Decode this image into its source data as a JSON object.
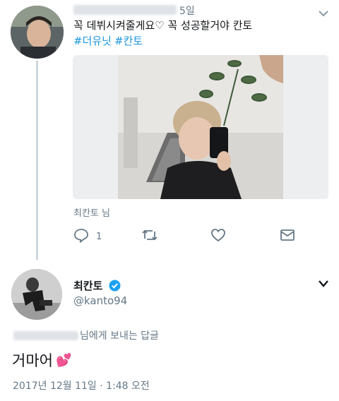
{
  "parent_tweet": {
    "time": "5일",
    "text": "꼭 데뷔시켜줄게요♡ 꼭 성공할거야 칸토",
    "hashtags": [
      "#더유닛",
      "#칸토"
    ],
    "replying_to": "최칸토 님",
    "actions": {
      "reply_count": "1"
    }
  },
  "main_tweet": {
    "display_name": "최칸토",
    "handle": "@kanto94",
    "replying_to_suffix": "님에게 보내는 답글",
    "text": "거마어",
    "emoji": "💕",
    "timestamp": "2017년 12월 11일 · 1:48 오전"
  },
  "icons": [
    "reply-icon",
    "retweet-icon",
    "like-icon",
    "dm-icon",
    "verified-icon",
    "chevron-down-icon"
  ],
  "colors": {
    "link": "#1b95e0",
    "muted": "#657786",
    "thread_line": "#ccd6dd",
    "verified": "#1da1f2"
  }
}
